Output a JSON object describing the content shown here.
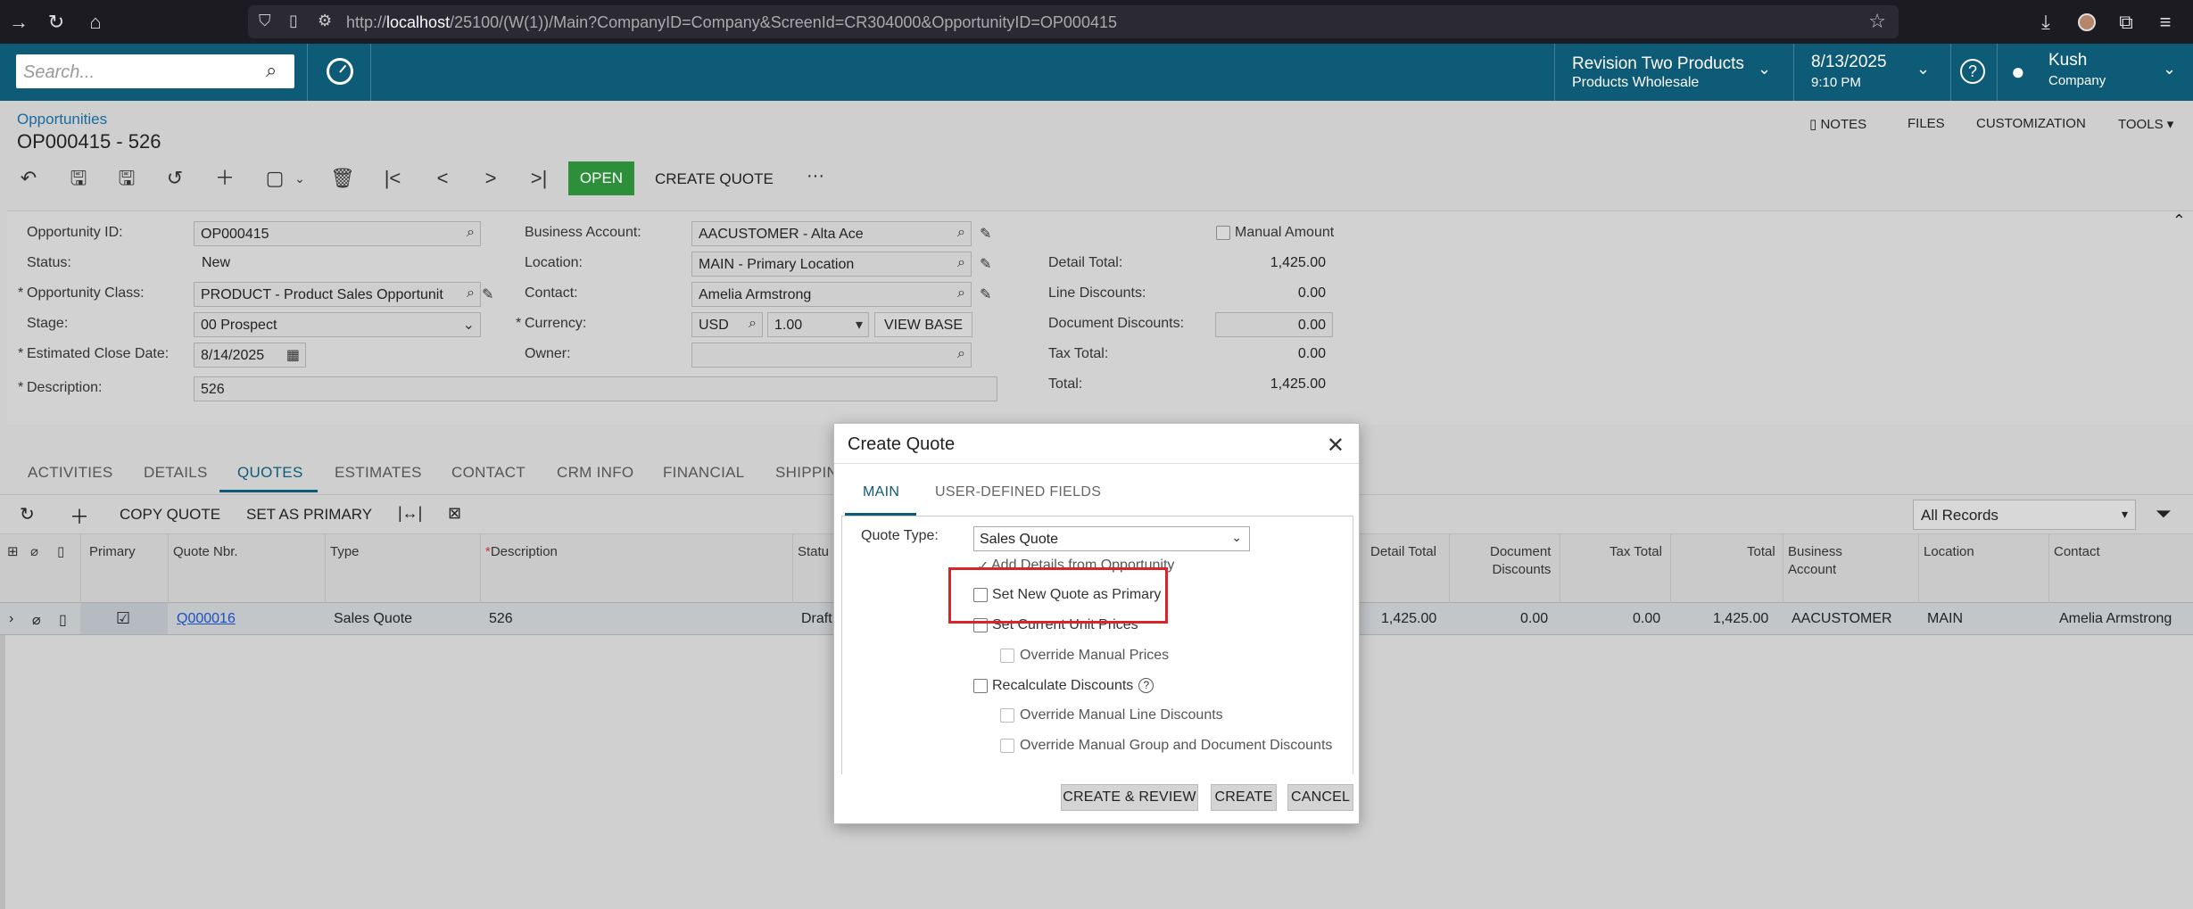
{
  "browser": {
    "url_prefix": "http://",
    "url_host": "localhost",
    "url_path": "/25100/(W(1))/Main?CompanyID=Company&ScreenId=CR304000&OpportunityID=OP000415"
  },
  "header": {
    "search_placeholder": "Search...",
    "company_name": "Revision Two Products",
    "company_branch": "Products Wholesale",
    "date": "8/13/2025",
    "time": "9:10 PM",
    "user_name": "Kush",
    "user_company": "Company"
  },
  "page": {
    "breadcrumb": "Opportunities",
    "title": "OP000415 - 526",
    "links": {
      "notes": "NOTES",
      "files": "FILES",
      "customization": "CUSTOMIZATION",
      "tools": "TOOLS"
    },
    "toolbar": {
      "open": "OPEN",
      "create_quote": "CREATE QUOTE",
      "more": "···"
    }
  },
  "form": {
    "opportunity_id_label": "Opportunity ID:",
    "opportunity_id": "OP000415",
    "status_label": "Status:",
    "status": "New",
    "class_label": "Opportunity Class:",
    "class": "PRODUCT - Product Sales Opportunit",
    "stage_label": "Stage:",
    "stage": "00 Prospect",
    "close_date_label": "Estimated Close Date:",
    "close_date": "8/14/2025",
    "description_label": "Description:",
    "description": "526",
    "business_account_label": "Business Account:",
    "business_account": "AACUSTOMER - Alta Ace",
    "location_label": "Location:",
    "location": "MAIN - Primary Location",
    "contact_label": "Contact:",
    "contact": "Amelia Armstrong",
    "currency_label": "Currency:",
    "currency": "USD",
    "rate": "1.00",
    "view_base": "VIEW BASE",
    "owner_label": "Owner:",
    "owner": "",
    "manual_amount_label": "Manual Amount",
    "detail_total_label": "Detail Total:",
    "detail_total": "1,425.00",
    "line_discounts_label": "Line Discounts:",
    "line_discounts": "0.00",
    "document_discounts_label": "Document Discounts:",
    "document_discounts": "0.00",
    "tax_total_label": "Tax Total:",
    "tax_total": "0.00",
    "total_label": "Total:",
    "total": "1,425.00"
  },
  "tabs": [
    "ACTIVITIES",
    "DETAILS",
    "QUOTES",
    "ESTIMATES",
    "CONTACT",
    "CRM INFO",
    "FINANCIAL",
    "SHIPPIN"
  ],
  "grid": {
    "toolbar": {
      "copy_quote": "COPY QUOTE",
      "set_as_primary": "SET AS PRIMARY",
      "filter": "All Records"
    },
    "headers": {
      "primary": "Primary",
      "quote_nbr": "Quote Nbr.",
      "type": "Type",
      "description": "Description",
      "status": "Statu",
      "detail_total": "Detail Total",
      "document_discounts_1": "Document",
      "document_discounts_2": "Discounts",
      "tax_total": "Tax Total",
      "total": "Total",
      "business_account_1": "Business",
      "business_account_2": "Account",
      "location": "Location",
      "contact": "Contact"
    },
    "row": {
      "quote_nbr": "Q000016",
      "type": "Sales Quote",
      "description": "526",
      "status": "Draft",
      "detail_total": "1,425.00",
      "document_discounts": "0.00",
      "tax_total": "0.00",
      "total": "1,425.00",
      "business_account": "AACUSTOMER",
      "location": "MAIN",
      "contact": "Amelia Armstrong"
    }
  },
  "dialog": {
    "title": "Create Quote",
    "tab_main": "MAIN",
    "tab_udf": "USER-DEFINED FIELDS",
    "quote_type_label": "Quote Type:",
    "quote_type": "Sales Quote",
    "add_details": "Add Details from Opportunity",
    "set_primary": "Set New Quote as Primary",
    "set_current_prices": "Set Current Unit Prices",
    "override_manual_prices": "Override Manual Prices",
    "recalculate_discounts": "Recalculate Discounts",
    "override_line_discounts": "Override Manual Line Discounts",
    "override_group_discounts": "Override Manual Group and Document Discounts",
    "btn_create_review": "CREATE & REVIEW",
    "btn_create": "CREATE",
    "btn_cancel": "CANCEL"
  }
}
